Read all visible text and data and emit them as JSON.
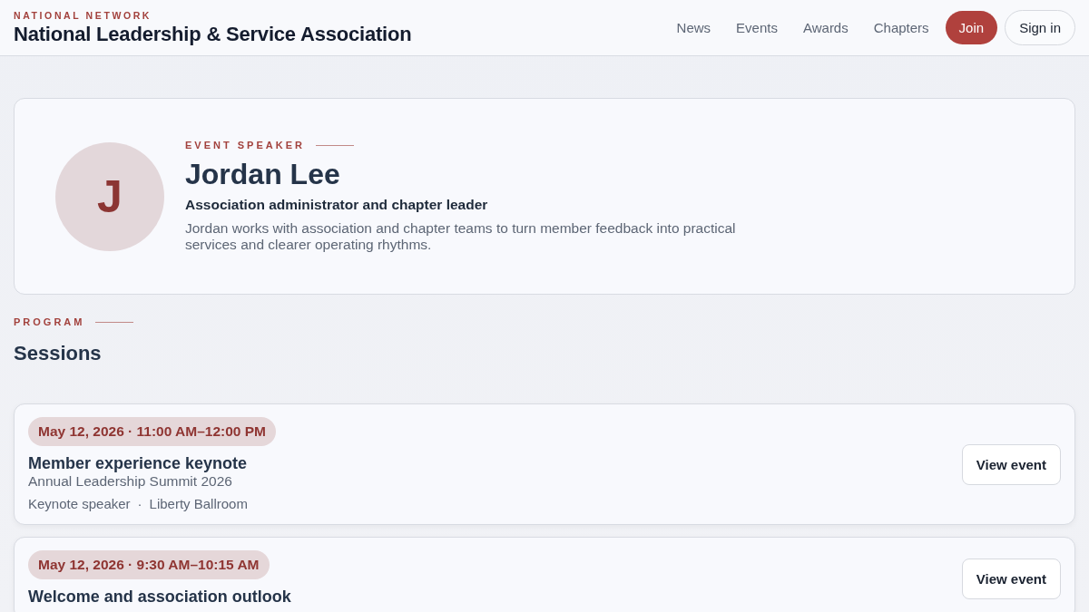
{
  "header": {
    "eyebrow": "NATIONAL NETWORK",
    "title": "National Leadership & Service Association",
    "nav": [
      {
        "label": "News",
        "kind": "link"
      },
      {
        "label": "Events",
        "kind": "link"
      },
      {
        "label": "Awards",
        "kind": "link"
      },
      {
        "label": "Chapters",
        "kind": "link"
      },
      {
        "label": "Join",
        "kind": "primary"
      },
      {
        "label": "Sign in",
        "kind": "outline"
      }
    ]
  },
  "speaker": {
    "eyebrow": "EVENT SPEAKER",
    "initial": "J",
    "name": "Jordan Lee",
    "role": "Association administrator and chapter leader",
    "bio": "Jordan works with association and chapter teams to turn member feedback into practical services and clearer operating rhythms."
  },
  "program": {
    "eyebrow": "PROGRAM",
    "heading": "Sessions",
    "separator": "·",
    "sessions": [
      {
        "when": "May 12, 2026 · 11:00 AM–12:00 PM",
        "title": "Member experience keynote",
        "event": "Annual Leadership Summit 2026",
        "meta": [
          "Keynote speaker",
          "Liberty Ballroom"
        ],
        "action": "View event"
      },
      {
        "when": "May 12, 2026 · 9:30 AM–10:15 AM",
        "title": "Welcome and association outlook",
        "action": "View event"
      }
    ]
  }
}
